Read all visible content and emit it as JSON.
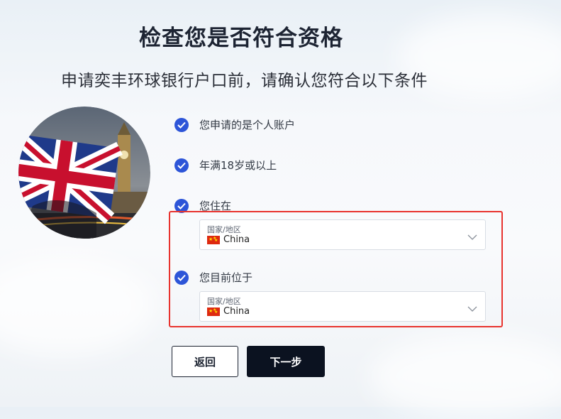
{
  "page": {
    "title": "检查您是否符合资格",
    "subtitle": "申请奕丰环球银行户口前，请确认您符合以下条件"
  },
  "hero_image": {
    "description_icon": "uk-flag-big-ben-image"
  },
  "conditions": [
    {
      "label": "您申请的是个人账户"
    },
    {
      "label": "年满18岁或以上"
    },
    {
      "label": "您住在"
    },
    {
      "label": "您目前位于"
    }
  ],
  "residence_select": {
    "field_label": "国家/地区",
    "value": "China",
    "flag_icon": "china-flag-icon"
  },
  "location_select": {
    "field_label": "国家/地区",
    "value": "China",
    "flag_icon": "china-flag-icon"
  },
  "buttons": {
    "back": "返回",
    "next": "下一步"
  },
  "colors": {
    "check": "#2d55d8",
    "highlight_border": "#e8332e",
    "primary_button": "#0b1220"
  }
}
